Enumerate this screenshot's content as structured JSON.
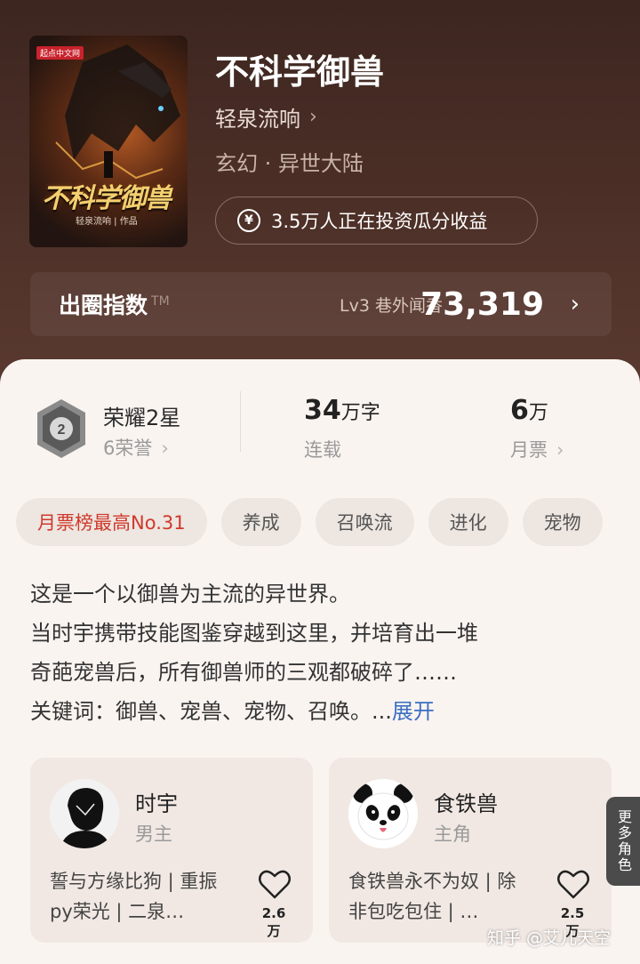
{
  "book": {
    "cover_publisher": "起点中文网",
    "cover_title": "不科学御兽",
    "cover_author": "轻泉流响 | 作品",
    "title": "不科学御兽",
    "author": "轻泉流响",
    "author_chevron": "›",
    "genre": "玄幻 · 异世大陆",
    "invest_text": "3.5万人正在投资瓜分收益",
    "yen_symbol": "¥"
  },
  "index_bar": {
    "label": "出圈指数",
    "trademark": "TM",
    "level": "Lv3 巷外闻香",
    "score": "73,319",
    "chevron": "›"
  },
  "stats": {
    "honor_name": "荣耀2星",
    "honor_sub": "6荣誉",
    "badge_number": "2",
    "words_value": "34",
    "words_unit": "万字",
    "words_label": "连载",
    "tickets_value": "6",
    "tickets_unit": "万",
    "tickets_label": "月票",
    "chevron": "›"
  },
  "tags": [
    "月票榜最高No.31",
    "养成",
    "召唤流",
    "进化",
    "宠物"
  ],
  "description": {
    "line1": "这是一个以御兽为主流的异世界。",
    "line2": "当时宇携带技能图鉴穿越到这里，并培育出一堆",
    "line3": "奇葩宠兽后，所有御兽师的三观都破碎了……",
    "line4": "关键词：御兽、宠兽、宠物、召唤。...",
    "expand": "展开"
  },
  "roles": [
    {
      "name": "时宇",
      "type": "男主",
      "desc": "誓与方缘比狗 | 重振py荣光 | 二泉…",
      "likes": "2.6万"
    },
    {
      "name": "食铁兽",
      "type": "主角",
      "desc": "食铁兽永不为奴 | 除非包吃包住 | …",
      "likes": "2.5万"
    }
  ],
  "more_roles": "更多角色",
  "watermark": "知乎 @艾儿天空",
  "colors": {
    "header_bg": "#4a2e26",
    "card_bg": "#faf4f0",
    "accent_red": "#d0392b",
    "link_blue": "#3b6ec2"
  }
}
